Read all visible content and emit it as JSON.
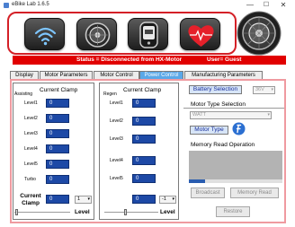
{
  "window": {
    "title": "eBike Lab 1.6.5",
    "minimize": "—",
    "maximize": "☐",
    "close": "✕"
  },
  "toolbar": {
    "icons": [
      "wifi-icon",
      "motor-icon",
      "display-icon",
      "heart-rate-icon",
      "motor-wheel-icon"
    ]
  },
  "status_bar": {
    "status": "Status = Disconnected from HX-Motor",
    "user": "User= Guest"
  },
  "tabs": [
    {
      "label": "Display",
      "active": false
    },
    {
      "label": "Motor Parameters",
      "active": false
    },
    {
      "label": "Motor Control",
      "active": false
    },
    {
      "label": "Power Control",
      "active": true
    },
    {
      "label": "Manufacturing Parameters",
      "active": false
    }
  ],
  "assisting": {
    "side_label": "Assisting",
    "heading": "Current Clamp",
    "levels": [
      {
        "label": "Level1",
        "value": "0"
      },
      {
        "label": "Level2",
        "value": "0"
      },
      {
        "label": "Level3",
        "value": "0"
      },
      {
        "label": "Level4",
        "value": "0"
      },
      {
        "label": "Level5",
        "value": "0"
      },
      {
        "label": "Turbo",
        "value": "0"
      }
    ],
    "clamp_label": "Current Clamp",
    "clamp_value": "0",
    "level_select": "1",
    "level_label": "Level"
  },
  "regen": {
    "side_label": "Regen",
    "heading": "Current Clamp",
    "levels": [
      {
        "label": "Level1",
        "value": "0"
      },
      {
        "label": "Level2",
        "value": "0"
      },
      {
        "label": "Level3",
        "value": "0"
      },
      {
        "label": "Level4",
        "value": "0"
      },
      {
        "label": "Level5",
        "value": "0"
      }
    ],
    "clamp_value": "0",
    "level_select": "-1",
    "level_label": "Level"
  },
  "right_panel": {
    "battery_selection_label": "Battery Selection",
    "battery_voltage": "36V",
    "motor_type_selection_label": "Motor Type Selection",
    "motor_type_value": "WATT",
    "motor_type_button": "Motor Type",
    "memory_read_label": "Memory Read Operation",
    "progress_percent": 17,
    "broadcast_button": "Broadcast",
    "memory_read_button": "Memory Read",
    "restore_button": "Restore"
  },
  "colors": {
    "accent_red": "#e10000",
    "tab_active": "#5aa8e8",
    "value_box": "#1d49a6",
    "progress_fill": "#2a5db0"
  }
}
